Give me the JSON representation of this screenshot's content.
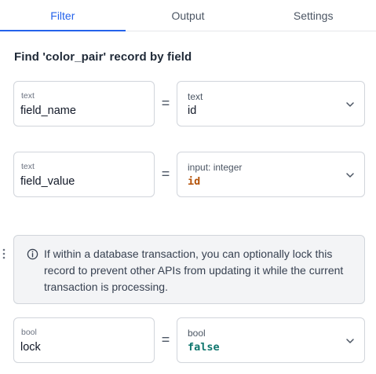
{
  "tabs": [
    {
      "label": "Filter",
      "active": true
    },
    {
      "label": "Output",
      "active": false
    },
    {
      "label": "Settings",
      "active": false
    }
  ],
  "heading": "Find 'color_pair' record by field",
  "rows": [
    {
      "left_type": "text",
      "left_value": "field_name",
      "operator": "=",
      "right_type": "text",
      "right_value": "id"
    },
    {
      "left_type": "text",
      "left_value": "field_value",
      "operator": "=",
      "right_type": "input: integer",
      "right_value": "id"
    },
    {
      "left_type": "bool",
      "left_value": "lock",
      "operator": "=",
      "right_type": "bool",
      "right_value": "false"
    }
  ],
  "info": {
    "text": "If within a database transaction, you can optionally lock this record to prevent other APIs from updating it while the current transaction is processing.",
    "icon": "info-circle-icon"
  },
  "colors": {
    "accent": "#2563eb",
    "integer_value": "#b45309",
    "bool_value": "#0f766e"
  }
}
